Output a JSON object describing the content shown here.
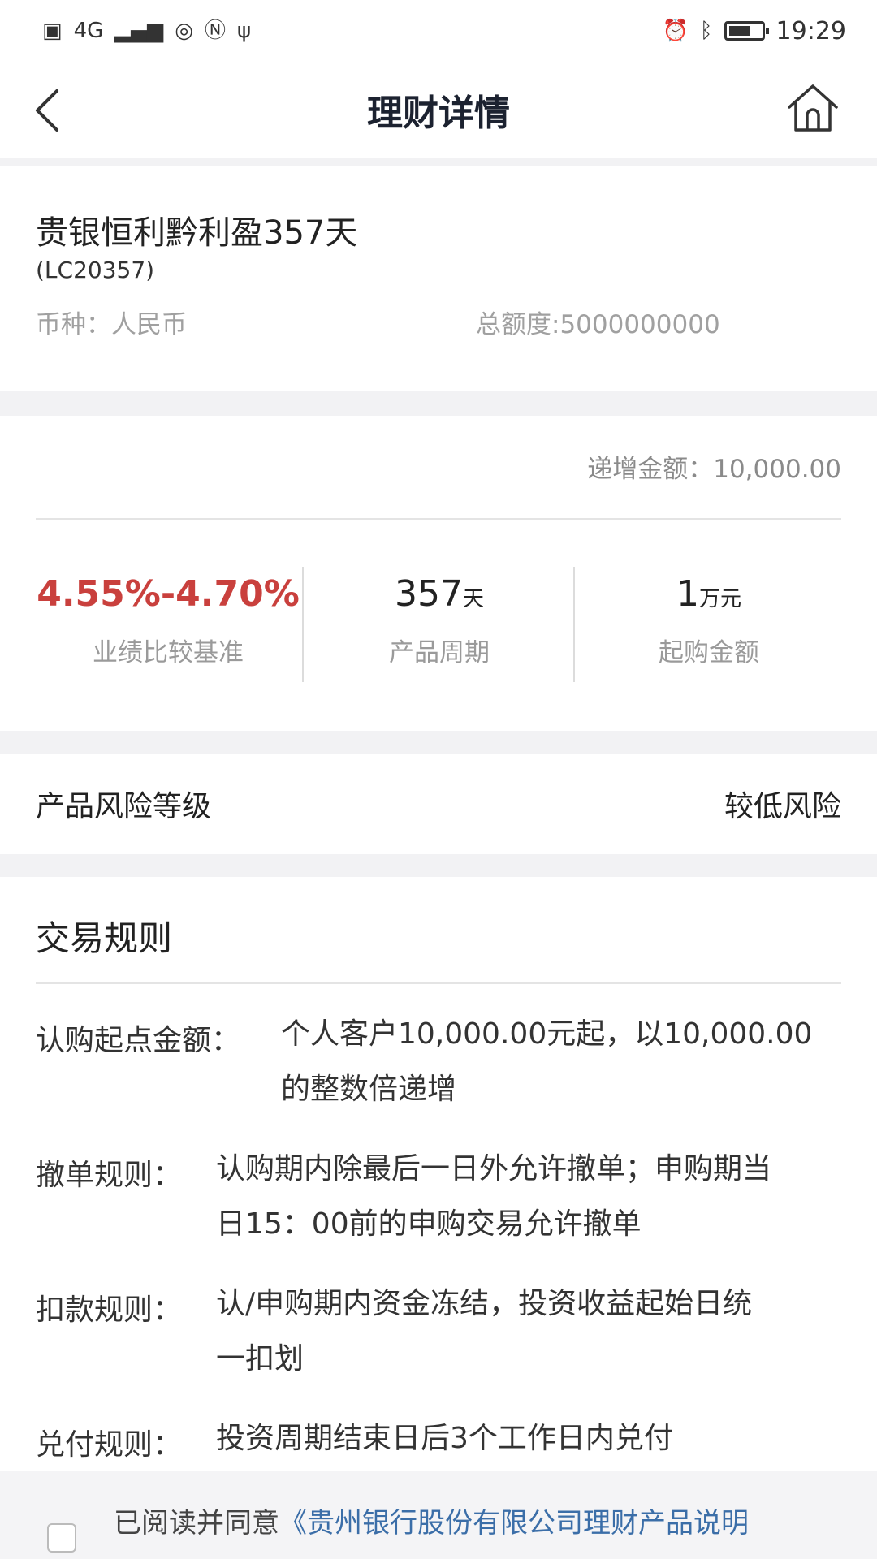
{
  "status_bar": {
    "network": "4G",
    "time": "19:29"
  },
  "nav": {
    "title": "理财详情"
  },
  "product": {
    "name": "贵银恒利黔利盈357天",
    "code": "(LC20357)",
    "currency": "币种：人民币",
    "total_quota": "总额度:5000000000"
  },
  "rate_card": {
    "increment": "递增金额：10,000.00",
    "rate_value": "4.55%-4.70%",
    "rate_label": "业绩比较基准",
    "period_value": "357",
    "period_unit": "天",
    "period_label": "产品周期",
    "min_value": "1",
    "min_unit": "万元",
    "min_label": "起购金额"
  },
  "risk": {
    "label": "产品风险等级",
    "value": "较低风险"
  },
  "rules": {
    "title": "交易规则",
    "items": [
      {
        "label": "认购起点金额：",
        "text_line1": "个人客户10,000.00元起，以10,000.00",
        "text_line2": "的整数倍递增"
      },
      {
        "label": "撤单规则：",
        "text_line1": "认购期内除最后一日外允许撤单；申购期当",
        "text_line2": "日15：00前的申购交易允许撤单"
      },
      {
        "label": "扣款规则：",
        "text_line1": "认/申购期内资金冻结，投资收益起始日统",
        "text_line2": "一扣划"
      },
      {
        "label": "兑付规则：",
        "text_line1": "投资周期结束日后3个工作日内兑付"
      }
    ]
  },
  "footer": {
    "agree_prefix": "已阅读并同意",
    "agree_link": "《贵州银行股份有限公司理财产品说明"
  }
}
